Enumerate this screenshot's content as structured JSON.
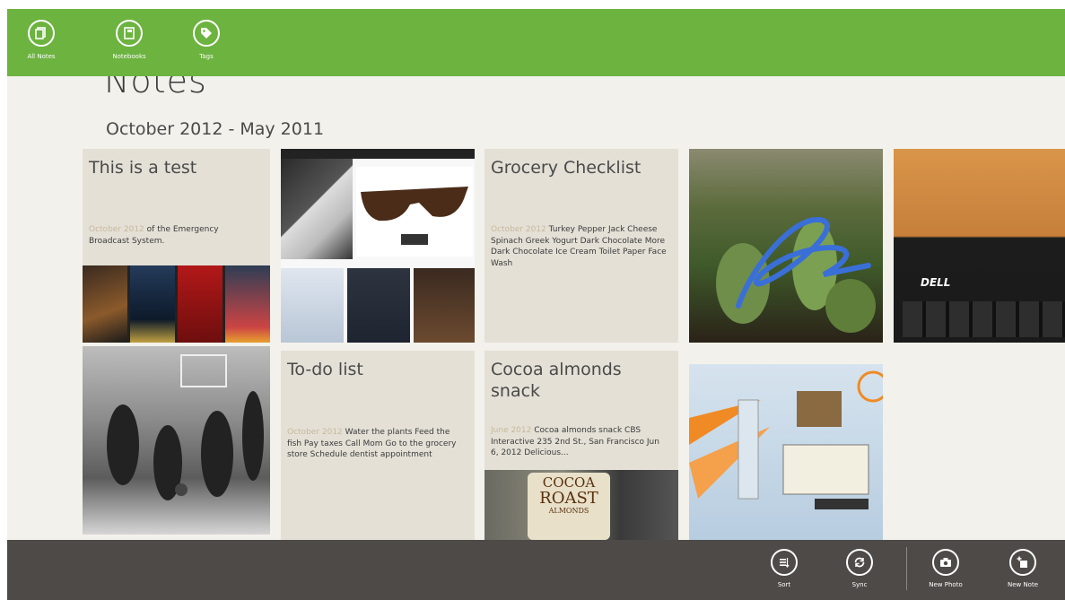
{
  "topbar": {
    "buttons": [
      {
        "label": "All Notes",
        "icon": "all-notes-icon"
      },
      {
        "label": "Notebooks",
        "icon": "notebook-icon"
      },
      {
        "label": "Tags",
        "icon": "tag-icon"
      }
    ]
  },
  "page": {
    "title": "Notes",
    "group_title": "October 2012 - May 2011"
  },
  "notes": {
    "test": {
      "title": "This is a test",
      "date": "October 2012",
      "snippet": "of the Emergency Broadcast System."
    },
    "grocery": {
      "title": "Grocery Checklist",
      "date": "October 2012",
      "snippet": "Turkey Pepper Jack Cheese Spinach Greek Yogurt Dark Chocolate More Dark Chocolate Ice Cream Toilet Paper Face Wash"
    },
    "todo": {
      "title": "To-do list",
      "date": "October 2012",
      "snippet": "Water the plants Feed the fish Pay taxes Call Mom Go to the grocery store Schedule dentist appointment"
    },
    "cocoa": {
      "title": "Cocoa almonds snack",
      "date": "June 2012",
      "snippet": "Cocoa almonds snack CBS Interactive 235 2nd St., San Francisco Jun 6, 2012 Delicious..."
    }
  },
  "image_text": {
    "keyboard_brand": "DELL",
    "can_line1": "COCOA",
    "can_line2": "ROAST",
    "can_line3": "ALMONDS"
  },
  "bottombar": {
    "buttons": [
      {
        "label": "Sort",
        "icon": "sort-icon"
      },
      {
        "label": "Sync",
        "icon": "sync-icon"
      },
      {
        "label": "New Photo",
        "icon": "camera-icon"
      },
      {
        "label": "New Note",
        "icon": "new-note-icon"
      }
    ]
  },
  "colors": {
    "accent_green": "#6cb33f",
    "appbar_dark": "#4d4a47",
    "tile_text_bg": "#e4e0d6",
    "date_text": "#c8b89a"
  }
}
